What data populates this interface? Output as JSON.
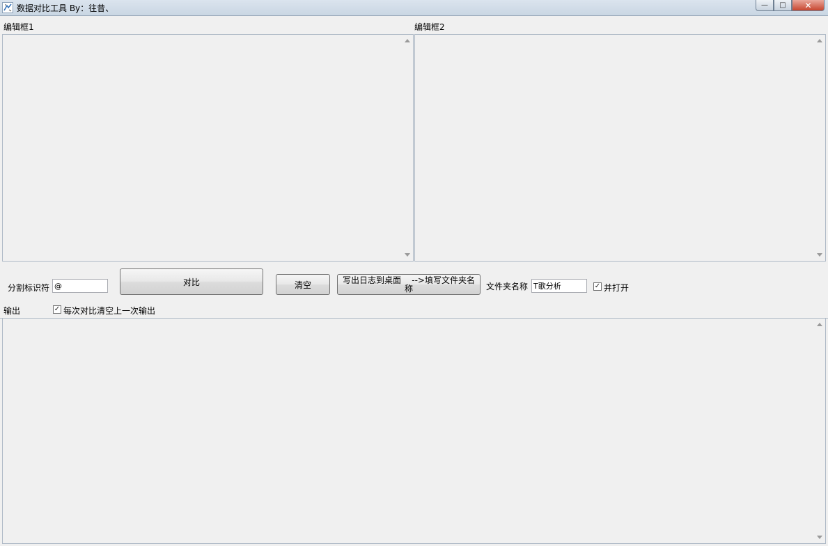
{
  "window": {
    "title": "数据对比工具  By：往昔、",
    "minimize_glyph": "—",
    "maximize_glyph": "□",
    "close_glyph": "✕"
  },
  "editor1": {
    "label": "编辑框1",
    "value": ""
  },
  "editor2": {
    "label": "编辑框2",
    "value": ""
  },
  "controls": {
    "separator_label": "分割标识符",
    "separator_value": "@",
    "compare_button": "对比",
    "clear_button": "清空",
    "export_button_line1": "写出日志到桌面    -->填写文件夹名",
    "export_button_line2": "称",
    "folder_name_label": "文件夹名称",
    "folder_name_value": "T歌分析",
    "open_checkbox_label": "并打开",
    "open_checked": true
  },
  "output": {
    "label": "输出",
    "clear_each_label": "每次对比清空上一次输出",
    "clear_each_checked": true,
    "value": ""
  },
  "icons": {
    "app": "app-icon",
    "check_glyph": "✓"
  }
}
